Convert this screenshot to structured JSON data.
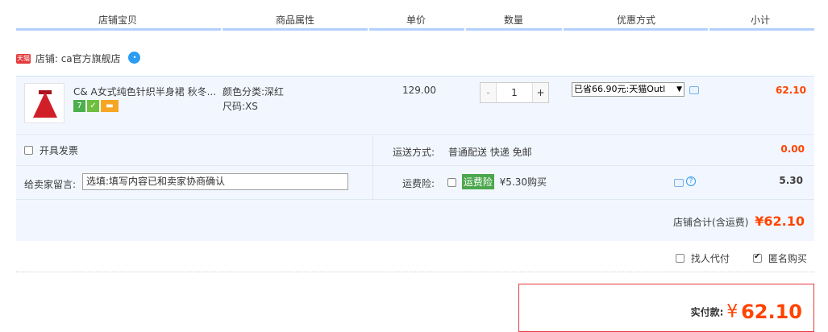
{
  "header": {
    "col_shop_item": "店铺宝贝",
    "col_attributes": "商品属性",
    "col_unit_price": "单价",
    "col_quantity": "数量",
    "col_discount": "优惠方式",
    "col_subtotal": "小计"
  },
  "shop": {
    "tmall_badge": "天猫",
    "label": "店铺:",
    "name": "ca官方旗舰店",
    "chat_icon": "wangwang-chat-icon"
  },
  "item": {
    "title": "C& A女式纯色针织半身裙 秋冬...",
    "color_label": "颜色分类:",
    "color_value": "深红",
    "size_label": "尺码:",
    "size_value": "XS",
    "unit_price": "129.00",
    "qty_minus": "-",
    "qty_value": "1",
    "qty_plus": "+",
    "promo_selected": "已省66.90元:天猫Outl",
    "subtotal": "62.10"
  },
  "options": {
    "invoice_label": "开具发票",
    "shipping_label": "运送方式:",
    "shipping_value": "普通配送 快递 免邮",
    "shipping_cost": "0.00",
    "message_label": "给卖家留言:",
    "message_placeholder": "选填:填写内容已和卖家协商确认",
    "insurance_label": "运费险:",
    "insurance_tag": "运费险",
    "insurance_price": "¥5.30购买",
    "insurance_cost": "5.30",
    "shop_total_label": "店铺合计(含运费)",
    "shop_total_value": "¥62.10"
  },
  "agent": {
    "pay_for_me_label": "找人代付",
    "anonymous_label": "匿名购买",
    "anonymous_checked": true
  },
  "payment": {
    "actual_label": "实付款:",
    "currency": "¥",
    "amount": "62.10"
  },
  "colors": {
    "accent_red": "#ff4400",
    "header_border": "#b2d1ff",
    "row_bg": "#f2f7ff",
    "insurance_green": "#4ca64c"
  }
}
